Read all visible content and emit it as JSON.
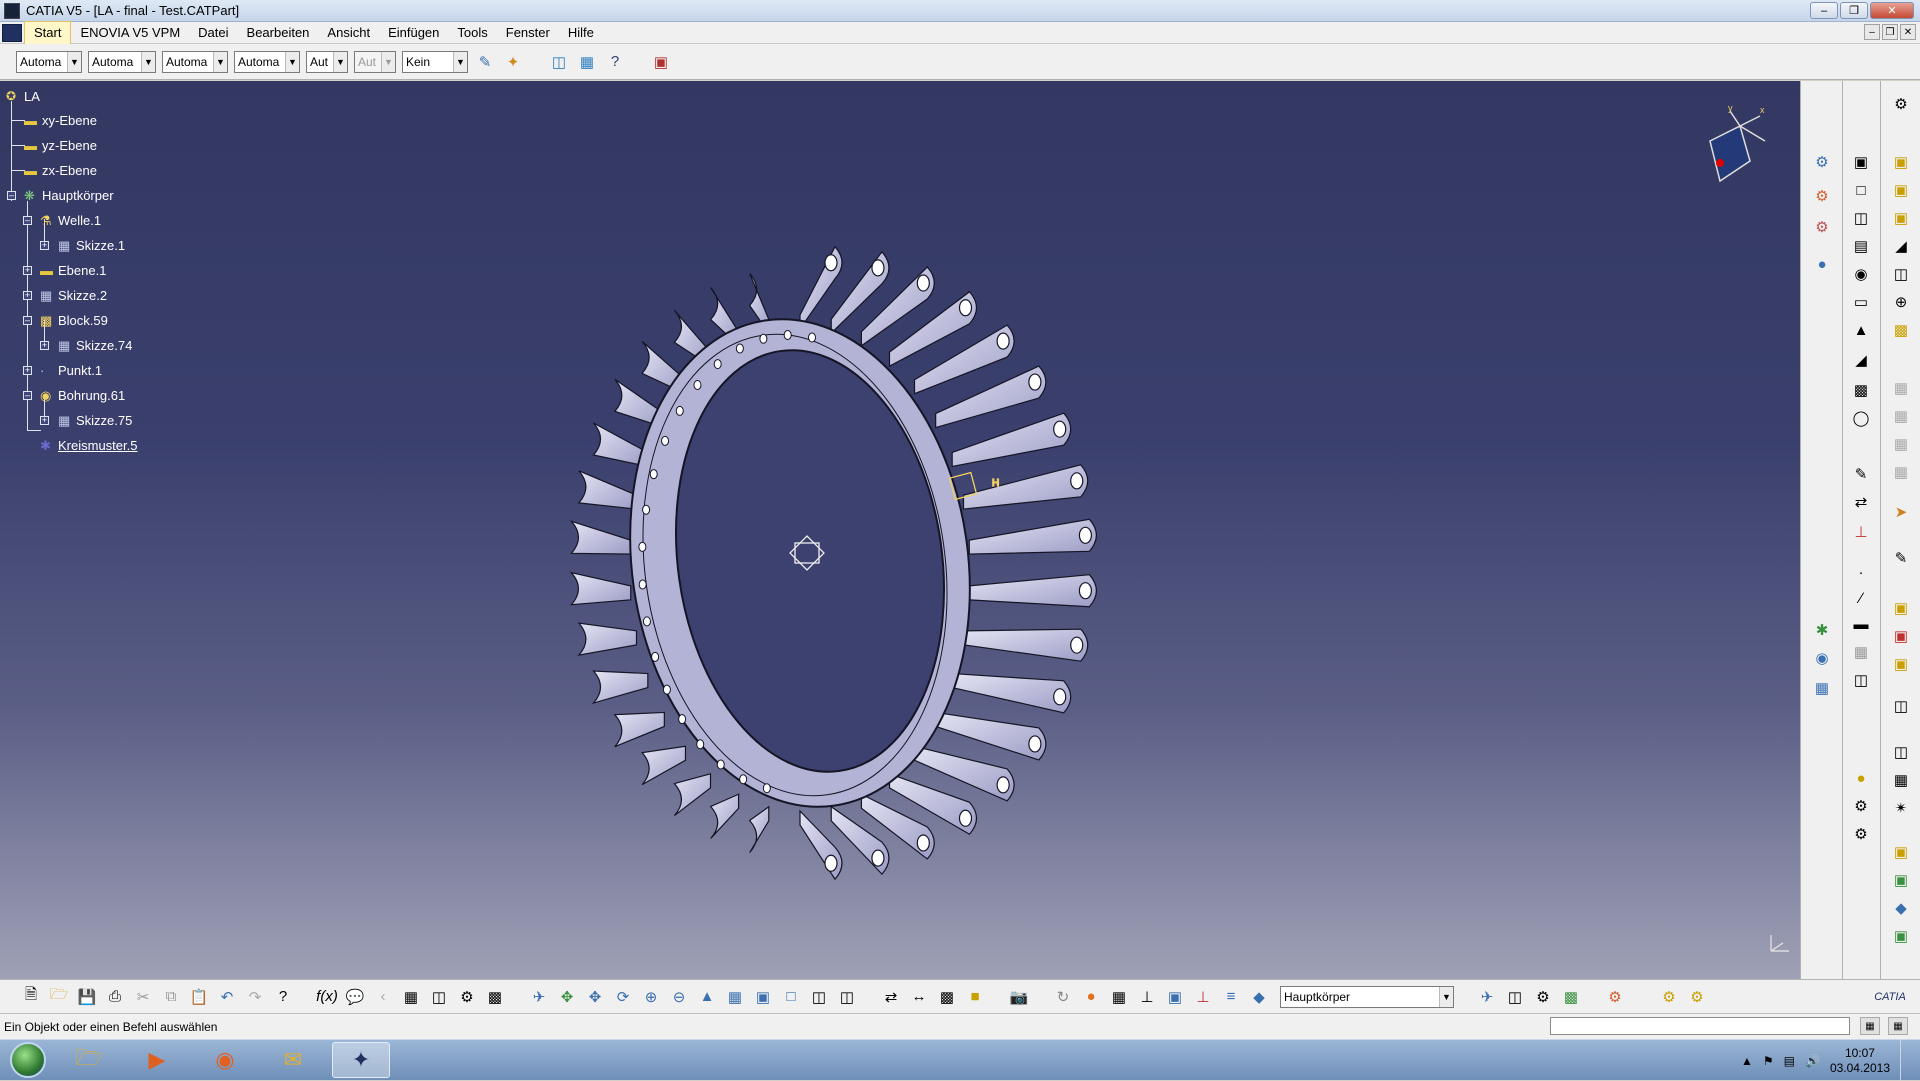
{
  "window": {
    "title": "CATIA V5 - [LA - final - Test.CATPart]"
  },
  "menu": {
    "items": [
      "Start",
      "ENOVIA V5 VPM",
      "Datei",
      "Bearbeiten",
      "Ansicht",
      "Einfügen",
      "Tools",
      "Fenster",
      "Hilfe"
    ]
  },
  "toolbar": {
    "combos": [
      {
        "value": "Automa"
      },
      {
        "value": "Automa"
      },
      {
        "value": "Automa"
      },
      {
        "value": "Automa"
      },
      {
        "value": "Aut"
      },
      {
        "value": "Aut",
        "disabled": true
      },
      {
        "value": "Kein"
      }
    ]
  },
  "tree": {
    "root": "LA",
    "nodes": [
      {
        "label": "xy-Ebene",
        "icon": "plane-icon"
      },
      {
        "label": "yz-Ebene",
        "icon": "plane-icon"
      },
      {
        "label": "zx-Ebene",
        "icon": "plane-icon"
      },
      {
        "label": "Hauptkörper",
        "icon": "body-icon"
      },
      {
        "label": "Welle.1",
        "icon": "shaft-icon"
      },
      {
        "label": "Skizze.1",
        "icon": "sketch-icon"
      },
      {
        "label": "Ebene.1",
        "icon": "plane-icon"
      },
      {
        "label": "Skizze.2",
        "icon": "sketch-icon"
      },
      {
        "label": "Block.59",
        "icon": "pad-icon"
      },
      {
        "label": "Skizze.74",
        "icon": "sketch-icon"
      },
      {
        "label": "Punkt.1",
        "icon": "point-icon"
      },
      {
        "label": "Bohrung.61",
        "icon": "hole-icon"
      },
      {
        "label": "Skizze.75",
        "icon": "sketch-icon"
      },
      {
        "label": "Kreismuster.5",
        "icon": "circular-pattern-icon"
      }
    ]
  },
  "bottom_toolbar": {
    "body_select": "Hauptkörper"
  },
  "status": {
    "message": "Ein Objekt oder einen Befehl auswählen"
  },
  "taskbar": {
    "time": "10:07",
    "date": "03.04.2013"
  },
  "colors": {
    "viewport_top": "#333862",
    "viewport_bottom": "#9fa1b6",
    "part": "#c9c9e6"
  }
}
